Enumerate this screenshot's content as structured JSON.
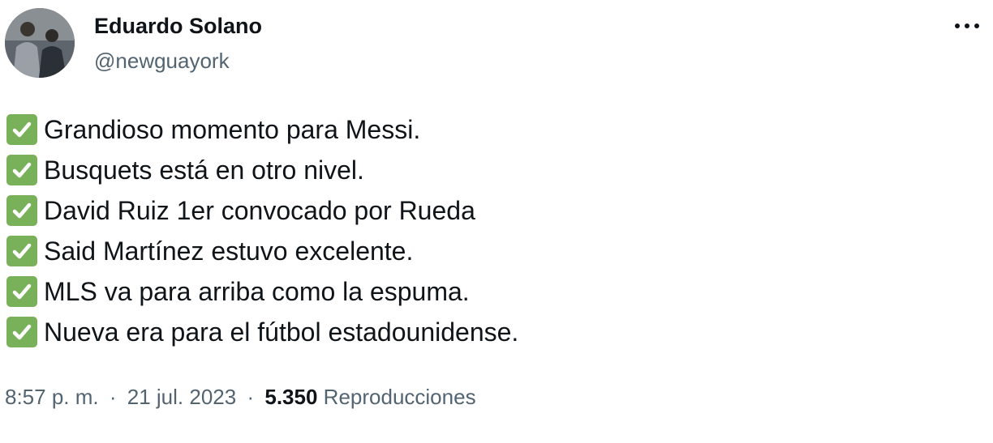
{
  "author": {
    "name": "Eduardo Solano",
    "handle": "@newguayork"
  },
  "tweet": {
    "lines": [
      {
        "icon": "white-check-mark-emoji",
        "text": "Grandioso momento para Messi."
      },
      {
        "icon": "white-check-mark-emoji",
        "text": "Busquets está en otro nivel."
      },
      {
        "icon": "white-check-mark-emoji",
        "text": "David Ruiz 1er convocado por Rueda"
      },
      {
        "icon": "white-check-mark-emoji",
        "text": "Said Martínez estuvo excelente."
      },
      {
        "icon": "white-check-mark-emoji",
        "text": "MLS va para arriba como la espuma."
      },
      {
        "icon": "white-check-mark-emoji",
        "text": "Nueva era para el fútbol estadounidense."
      }
    ]
  },
  "meta": {
    "time": "8:57 p. m.",
    "separator": "·",
    "date": "21 jul. 2023",
    "views_count": "5.350",
    "views_label": "Reproducciones"
  },
  "icons": {
    "more": "more-horizontal-icon",
    "check": "check-mark-emoji"
  },
  "colors": {
    "text": "#0f1419",
    "secondary": "#536471",
    "check_green": "#78b159"
  }
}
